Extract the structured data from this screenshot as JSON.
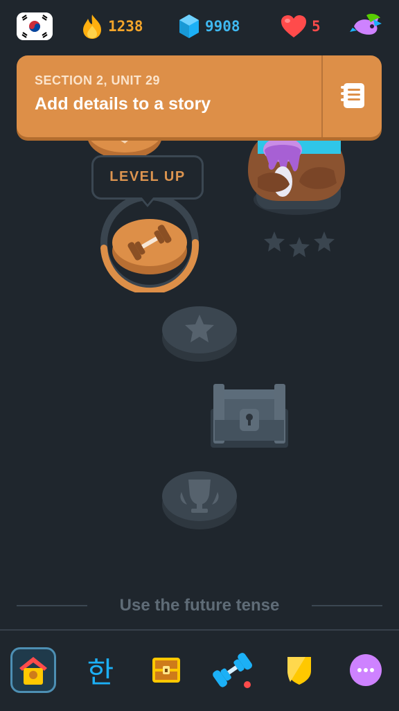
{
  "top_bar": {
    "streak_count": "1238",
    "gems_count": "9908",
    "hearts_count": "5",
    "colors": {
      "streak": "#f4a52a",
      "gems": "#3fb8f0",
      "hearts": "#ff4b4b"
    }
  },
  "unit_banner": {
    "section_label": "SECTION 2, UNIT 29",
    "title": "Add details to a story",
    "color": "#dd8f48"
  },
  "path": {
    "tooltip_label": "LEVEL UP",
    "nodes": [
      {
        "type": "lesson",
        "state": "active",
        "icon": "dumbbell-icon"
      },
      {
        "type": "star",
        "state": "locked",
        "icon": "star-icon"
      },
      {
        "type": "chest",
        "state": "locked",
        "icon": "treasure-chest-icon"
      },
      {
        "type": "trophy",
        "state": "locked",
        "icon": "trophy-icon"
      }
    ]
  },
  "next_unit_divider": "Use the future tense",
  "bottom_nav": {
    "items": [
      {
        "name": "learn",
        "icon": "home-icon",
        "active": true
      },
      {
        "name": "letters",
        "label": "한",
        "active": false
      },
      {
        "name": "quests",
        "icon": "chest-icon",
        "active": false
      },
      {
        "name": "practice",
        "icon": "dumbbell-icon",
        "active": false
      },
      {
        "name": "leagues",
        "icon": "shield-icon",
        "active": false
      },
      {
        "name": "more",
        "icon": "more-icon",
        "active": false
      }
    ]
  }
}
